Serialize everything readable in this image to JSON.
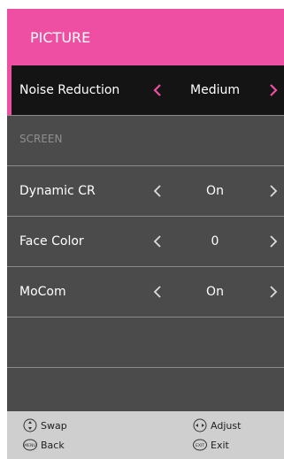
{
  "header": {
    "title": "PICTURE"
  },
  "menu": {
    "section_label": "SCREEN",
    "items": [
      {
        "label": "Noise Reduction",
        "value": "Medium"
      },
      {
        "label": "Dynamic CR",
        "value": "On"
      },
      {
        "label": "Face Color",
        "value": "0"
      },
      {
        "label": "MoCom",
        "value": "On"
      }
    ]
  },
  "footer": {
    "swap": "Swap",
    "adjust": "Adjust",
    "back": "Back",
    "exit": "Exit",
    "menu_btn": "MENU",
    "exit_btn": "EXIT"
  },
  "colors": {
    "accent": "#ef4fa2",
    "panel": "#4b4b4b",
    "selected": "#141414",
    "footer": "#cfcfcf"
  },
  "icons": [
    "chevron-left-icon",
    "chevron-right-icon",
    "up-down-icon",
    "left-right-icon",
    "menu-button-icon",
    "exit-button-icon"
  ]
}
